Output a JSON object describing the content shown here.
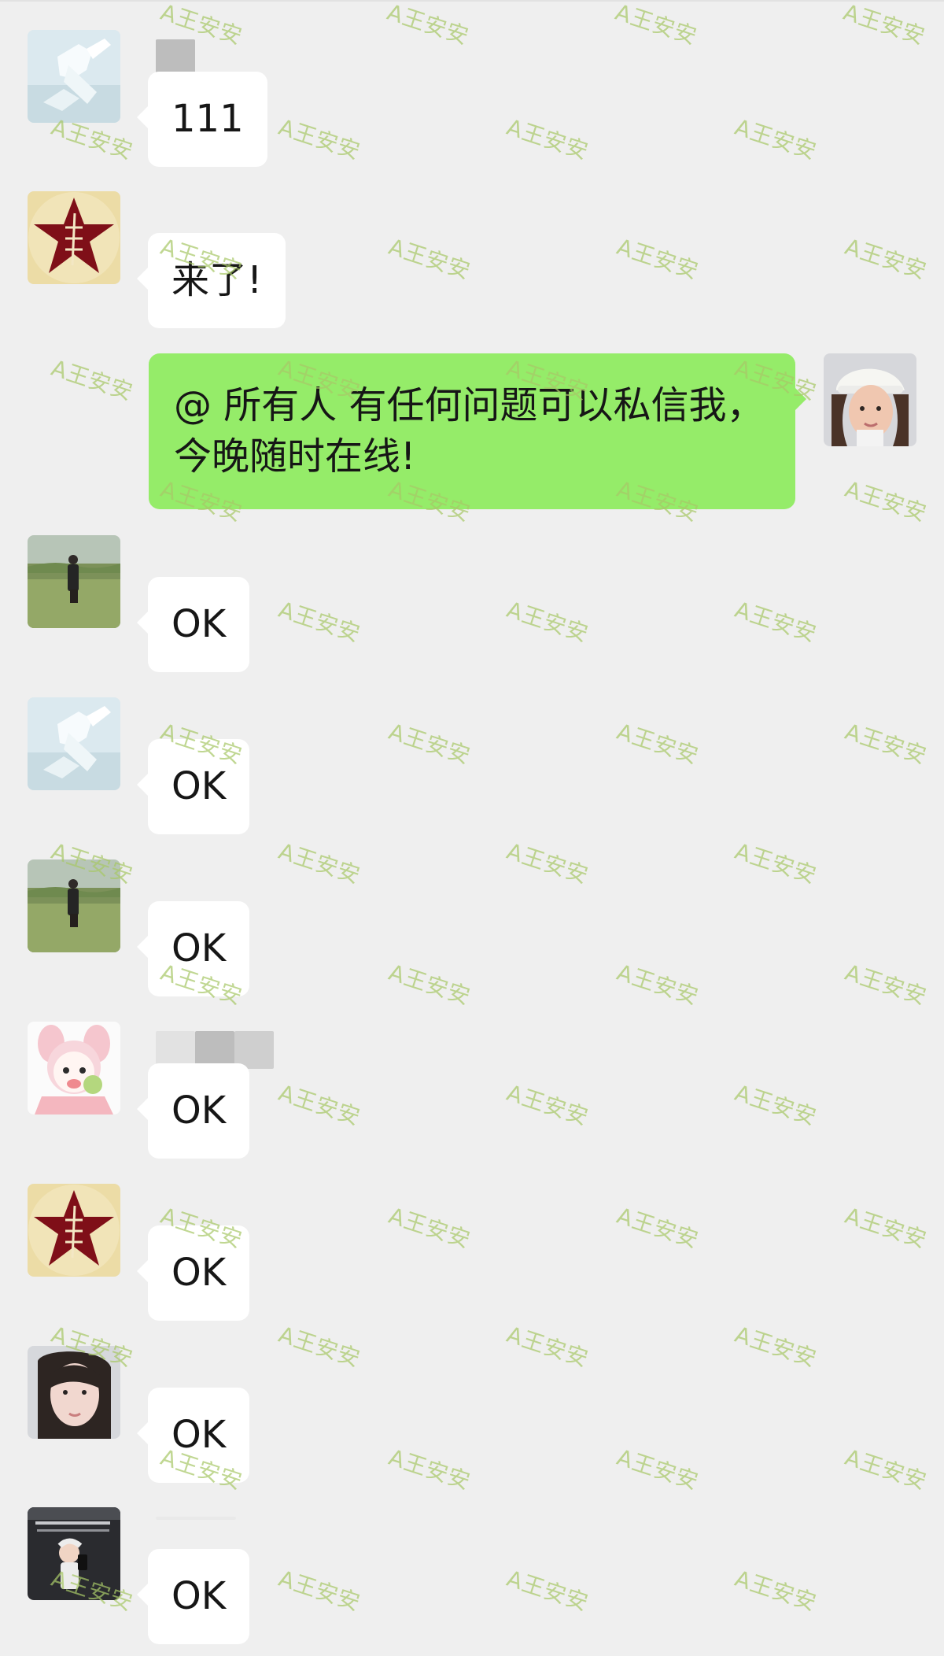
{
  "chat": {
    "messages": [
      {
        "side": "left",
        "avatar": "avatar-ice-sculpture",
        "sender_blur": "small",
        "text": "111"
      },
      {
        "side": "left",
        "avatar": "avatar-star",
        "sender_blur": "none",
        "text": "来了!"
      },
      {
        "side": "right",
        "avatar": "avatar-girl-cap",
        "sender_blur": "none",
        "text": "@ 所有人  有任何问题可以私信我，今晚随时在线!"
      },
      {
        "side": "left",
        "avatar": "avatar-field-person",
        "sender_blur": "none",
        "text": "OK"
      },
      {
        "side": "left",
        "avatar": "avatar-ice-sculpture",
        "sender_blur": "none",
        "text": "OK"
      },
      {
        "side": "left",
        "avatar": "avatar-field-person",
        "sender_blur": "none",
        "text": "OK"
      },
      {
        "side": "left",
        "avatar": "avatar-bunny-cartoon",
        "sender_blur": "large",
        "text": "OK"
      },
      {
        "side": "left",
        "avatar": "avatar-star",
        "sender_blur": "none",
        "text": "OK"
      },
      {
        "side": "left",
        "avatar": "avatar-woman-face",
        "sender_blur": "none",
        "text": "OK"
      },
      {
        "side": "left",
        "avatar": "avatar-mirror-selfie",
        "sender_blur": "none",
        "text": "OK"
      }
    ]
  },
  "watermark": {
    "text": "A王安安",
    "color": "#a8c768"
  },
  "colors": {
    "background": "#efefef",
    "bubble_white": "#ffffff",
    "bubble_green": "#95ec69",
    "text": "#161616"
  }
}
